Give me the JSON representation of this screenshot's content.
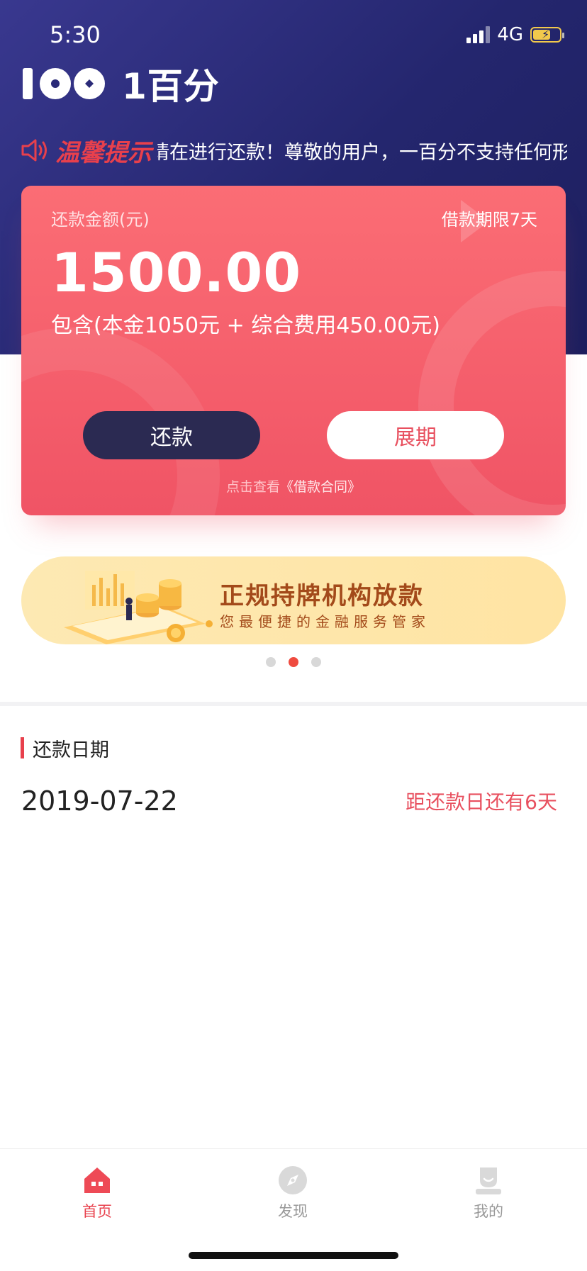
{
  "status_bar": {
    "time": "5:30",
    "network": "4G"
  },
  "brand": {
    "logo_mark": "100",
    "name": "1百分"
  },
  "notice": {
    "title": "温馨提示",
    "text": "请在进行还款！尊敬的用户，一百分不支持任何形"
  },
  "loan_card": {
    "amount_label": "还款金额(元)",
    "term": "借款期限7天",
    "amount": "1500.00",
    "breakdown": "包含(本金1050元 + 综合费用450.00元)",
    "repay_button": "还款",
    "extend_button": "展期",
    "contract_prefix": "点击查看",
    "contract_link": "《借款合同》"
  },
  "banner": {
    "title": "正规持牌机构放款",
    "subtitle": "您最便捷的金融服务管家",
    "dots": 3,
    "active_dot": 1
  },
  "repayment": {
    "section_title": "还款日期",
    "date": "2019-07-22",
    "days_left": "距还款日还有6天"
  },
  "tabbar": {
    "items": [
      {
        "label": "首页",
        "icon": "home-icon",
        "active": true
      },
      {
        "label": "发现",
        "icon": "compass-icon",
        "active": false
      },
      {
        "label": "我的",
        "icon": "user-icon",
        "active": false
      }
    ]
  },
  "colors": {
    "header": "#2a2a78",
    "accent": "#e8404c",
    "card": "#f25a68",
    "banner": "#fee6a8",
    "dark_button": "#2b2a52"
  }
}
